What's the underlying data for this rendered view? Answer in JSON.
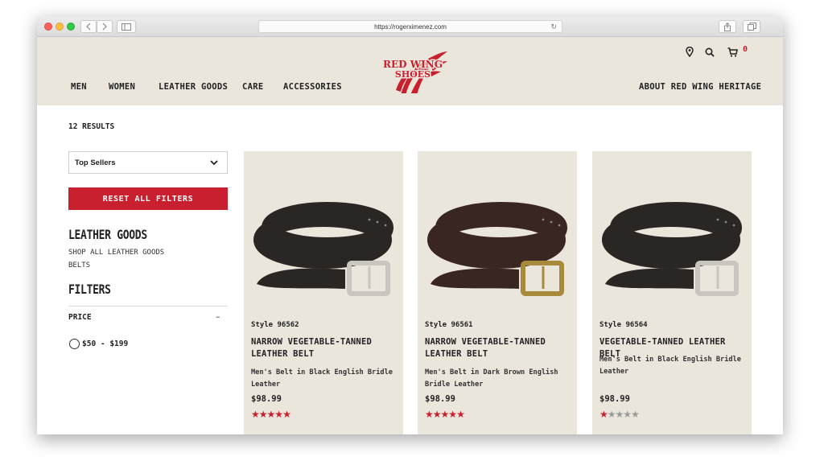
{
  "browser": {
    "url": "https://rogerximenez.com"
  },
  "header": {
    "logo_text": [
      "RED WING",
      "SHOES"
    ],
    "nav_left": [
      "MEN",
      "WOMEN",
      "LEATHER GOODS",
      "CARE",
      "ACCESSORIES"
    ],
    "nav_right": "ABOUT RED WING HERITAGE",
    "cart_count": "0"
  },
  "sidebar": {
    "results_count": "12 RESULTS",
    "sort_selected": "Top Sellers",
    "reset_label": "RESET ALL FILTERS",
    "category_heading": "LEATHER GOODS",
    "category_links": [
      "SHOP ALL LEATHER GOODS",
      "BELTS"
    ],
    "filters_heading": "FILTERS",
    "price_label": "PRICE",
    "price_collapse": "–",
    "price_option": "$50 - $199"
  },
  "products": [
    {
      "style": "Style 96562",
      "title": "NARROW VEGETABLE-TANNED LEATHER BELT",
      "description": "Men's Belt in Black English Bridle Leather",
      "price": "$98.99",
      "rating": 5,
      "leather_color": "#2a2624",
      "buckle_color": "#c9c6c0"
    },
    {
      "style": "Style 96561",
      "title": "NARROW VEGETABLE-TANNED LEATHER BELT",
      "description": "Men's Belt in Dark Brown English Bridle Leather",
      "price": "$98.99",
      "rating": 5,
      "leather_color": "#3a2620",
      "buckle_color": "#a88a3c"
    },
    {
      "style": "Style 96564",
      "title": "VEGETABLE-TANNED LEATHER BELT",
      "description": "Men's Belt in Black English Bridle Leather",
      "price": "$98.99",
      "rating": 1,
      "leather_color": "#2a2624",
      "buckle_color": "#c9c6c0"
    }
  ],
  "colors": {
    "brand_red": "#c8202f",
    "header_bg": "#ebe6dc",
    "card_bg": "#ebe6dc"
  }
}
